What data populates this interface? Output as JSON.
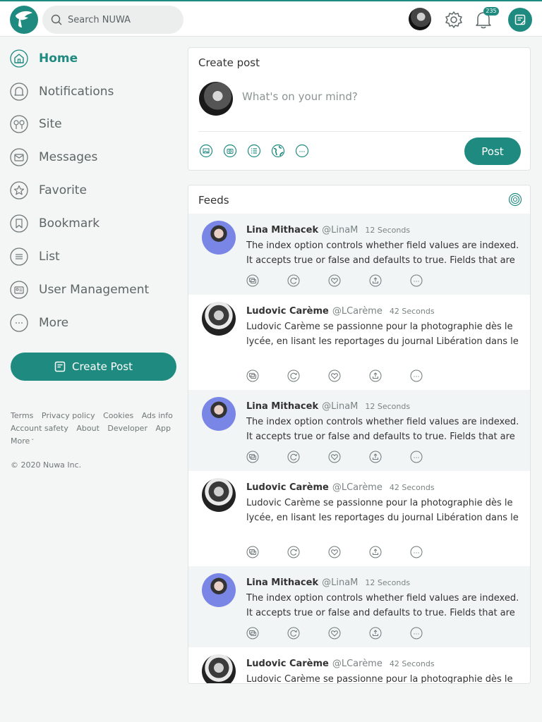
{
  "app": {
    "name": "NUWA",
    "search_placeholder": "Search NUWA",
    "notification_count": "235",
    "accent": "#1f8a80"
  },
  "sidebar": {
    "items": [
      {
        "label": "Home",
        "icon": "home-icon",
        "active": true
      },
      {
        "label": "Notifications",
        "icon": "bell-icon"
      },
      {
        "label": "Site",
        "icon": "site-icon"
      },
      {
        "label": "Messages",
        "icon": "mail-icon"
      },
      {
        "label": "Favorite",
        "icon": "star-icon"
      },
      {
        "label": "Bookmark",
        "icon": "bookmark-icon"
      },
      {
        "label": "List",
        "icon": "list-icon"
      },
      {
        "label": "User Management",
        "icon": "id-card-icon"
      },
      {
        "label": "More",
        "icon": "more-icon"
      }
    ],
    "create_post_label": "Create Post",
    "footer_links": [
      "Terms",
      "Privacy policy",
      "Cookies",
      "Ads info",
      "Account safety",
      "About",
      "Developer",
      "App",
      "More"
    ],
    "copyright": "© 2020 Nuwa Inc."
  },
  "create_post": {
    "title": "Create post",
    "placeholder": "What's on your mind?",
    "tools": [
      "image-icon",
      "camera-icon",
      "poll-icon",
      "globe-icon",
      "more-icon"
    ],
    "post_label": "Post"
  },
  "feeds": {
    "title": "Feeds",
    "posts": [
      {
        "name": "Lina Mithacek",
        "handle": "@LinaM",
        "time": "12 Seconds",
        "text": "The index option controls whether field values are indexed. It accepts true or false and defaults to true. Fields that are not"
      },
      {
        "name": "Ludovic Carème",
        "handle": "@LCarème",
        "time": "42 Seconds",
        "text": "Ludovic Carème se passionne pour la photographie dès le lycée, en lisant les reportages du journal Libération dans le"
      },
      {
        "name": "Lina Mithacek",
        "handle": "@LinaM",
        "time": "12 Seconds",
        "text": "The index option controls whether field values are indexed. It accepts true or false and defaults to true. Fields that are not"
      },
      {
        "name": "Ludovic Carème",
        "handle": "@LCarème",
        "time": "42 Seconds",
        "text": "Ludovic Carème se passionne pour la photographie dès le lycée, en lisant les reportages du journal Libération dans le"
      },
      {
        "name": "Lina Mithacek",
        "handle": "@LinaM",
        "time": "12 Seconds",
        "text": "The index option controls whether field values are indexed. It accepts true or false and defaults to true. Fields that are not"
      },
      {
        "name": "Ludovic Carème",
        "handle": "@LCarème",
        "time": "42 Seconds",
        "text": "Ludovic Carème se passionne pour la photographie dès le lycée, en lisant les reportages du journal Libération dans le"
      }
    ],
    "actions": [
      "comment-icon",
      "repost-icon",
      "like-icon",
      "share-icon",
      "more-icon"
    ]
  }
}
